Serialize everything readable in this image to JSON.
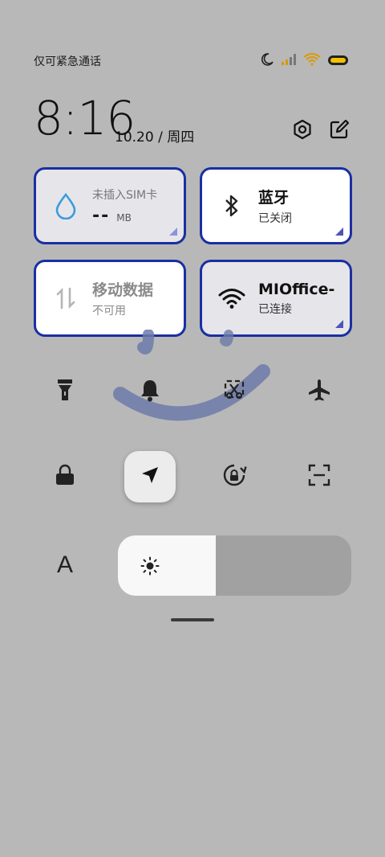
{
  "status_bar": {
    "carrier_text": "仅可紧急通话",
    "icons": [
      "moon-icon",
      "signal-icon",
      "wifi-icon",
      "battery-icon"
    ],
    "battery_fill_color": "#f2c200"
  },
  "header": {
    "time": "8:16",
    "date": "10.20",
    "separator": "/",
    "weekday": "周四",
    "settings_icon": "settings-icon",
    "edit_icon": "edit-icon"
  },
  "tiles": {
    "sim": {
      "title": "未插入SIM卡",
      "value": "--",
      "unit": "MB",
      "icon": "water-drop-icon"
    },
    "bluetooth": {
      "title": "蓝牙",
      "status": "已关闭",
      "icon": "bluetooth-icon"
    },
    "mobile_data": {
      "title": "移动数据",
      "status": "不可用",
      "icon": "data-arrows-icon"
    },
    "wifi": {
      "title": "MIOffice-",
      "status": "已连接",
      "icon": "wifi-icon"
    }
  },
  "toggles_row1": [
    "flashlight-icon",
    "bell-icon",
    "screenshot-icon",
    "airplane-icon"
  ],
  "toggles_row2": [
    "lock-icon",
    "location-icon",
    "rotation-lock-icon",
    "scan-icon"
  ],
  "brightness": {
    "level": 0.42,
    "auto_label": "A"
  },
  "colors": {
    "accent_border": "#1a2fa1",
    "corner": "#4a54b9",
    "drop_icon": "#3d9bde"
  }
}
